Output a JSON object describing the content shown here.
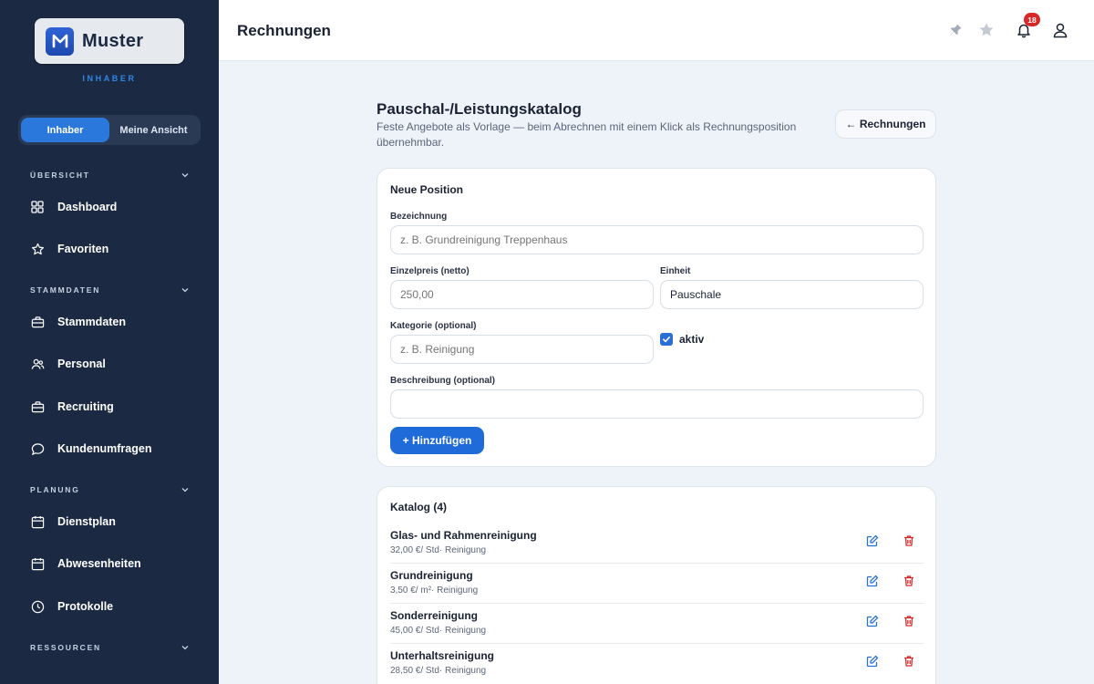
{
  "brand": {
    "name": "Muster",
    "role_caption": "INHABER"
  },
  "view_toggle": {
    "options": [
      "Inhaber",
      "Meine Ansicht"
    ],
    "active": "Inhaber"
  },
  "sidebar": {
    "sections": [
      {
        "title": "ÜBERSICHT",
        "items": [
          {
            "label": "Dashboard",
            "icon": "grid-icon"
          },
          {
            "label": "Favoriten",
            "icon": "star-icon"
          }
        ]
      },
      {
        "title": "STAMMDATEN",
        "items": [
          {
            "label": "Stammdaten",
            "icon": "briefcase-icon"
          },
          {
            "label": "Personal",
            "icon": "users-icon"
          },
          {
            "label": "Recruiting",
            "icon": "briefcase-icon"
          },
          {
            "label": "Kundenumfragen",
            "icon": "chat-icon"
          }
        ]
      },
      {
        "title": "PLANUNG",
        "items": [
          {
            "label": "Dienstplan",
            "icon": "calendar-icon"
          },
          {
            "label": "Abwesenheiten",
            "icon": "calendar-icon"
          },
          {
            "label": "Protokolle",
            "icon": "clock-icon"
          }
        ]
      },
      {
        "title": "RESSOURCEN",
        "items": []
      }
    ]
  },
  "header": {
    "title": "Rechnungen",
    "notification_count": "18"
  },
  "page": {
    "title": "Pauschal-/Leistungskatalog",
    "subtitle": "Feste Angebote als Vorlage — beim Abrechnen mit einem Klick als Rechnungsposition übernehmbar.",
    "back_button": "← Rechnungen"
  },
  "form": {
    "title": "Neue Position",
    "bezeichnung": {
      "label": "Bezeichnung",
      "value": "",
      "placeholder": "z. B. Grundreinigung Treppenhaus"
    },
    "einzelpreis": {
      "label": "Einzelpreis (netto)",
      "value": "",
      "placeholder": "250,00"
    },
    "einheit": {
      "label": "Einheit",
      "value": "Pauschale",
      "placeholder": ""
    },
    "kategorie": {
      "label": "Kategorie (optional)",
      "value": "",
      "placeholder": "z. B. Reinigung"
    },
    "aktiv": {
      "label": "aktiv",
      "checked": true
    },
    "beschreibung": {
      "label": "Beschreibung (optional)",
      "value": "",
      "placeholder": ""
    },
    "submit_label": "+ Hinzufügen"
  },
  "catalog": {
    "title": "Katalog (4)",
    "items": [
      {
        "name": "Glas- und Rahmenreinigung",
        "meta": "32,00 €/ Std· Reinigung"
      },
      {
        "name": "Grundreinigung",
        "meta": "3,50 €/ m²· Reinigung"
      },
      {
        "name": "Sonderreinigung",
        "meta": "45,00 €/ Std· Reinigung"
      },
      {
        "name": "Unterhaltsreinigung",
        "meta": "28,50 €/ Std· Reinigung"
      }
    ]
  },
  "colors": {
    "sidebar": "#1b2942",
    "accent": "#1f6bd9",
    "danger": "#d92626",
    "background": "#eef3fa"
  }
}
